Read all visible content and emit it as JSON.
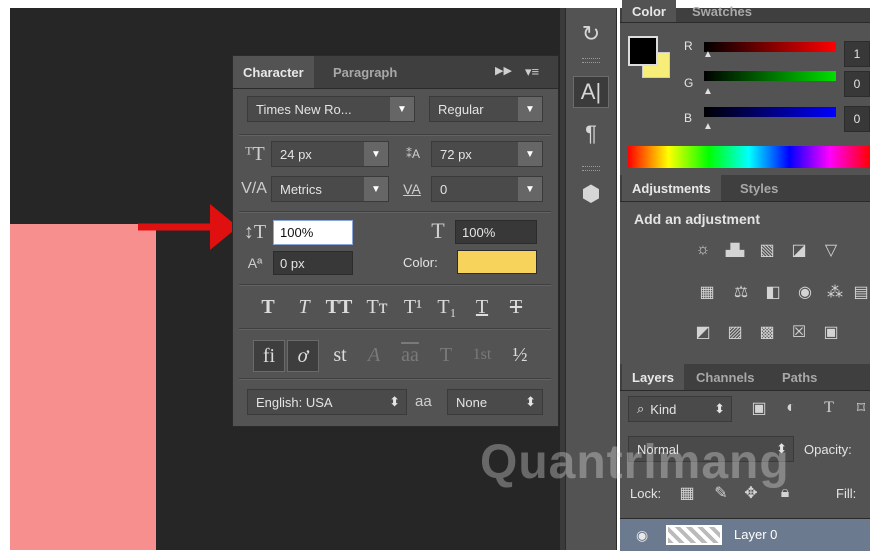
{
  "character_panel": {
    "tabs": [
      "Character",
      "Paragraph"
    ],
    "font_family": "Times New Ro...",
    "font_style": "Regular",
    "font_size": "24 px",
    "leading": "72 px",
    "kerning": "Metrics",
    "tracking": "0",
    "vertical_scale": "100%",
    "horizontal_scale": "100%",
    "baseline_shift": "0 px",
    "color_label": "Color:",
    "color_value": "#f7d35b",
    "type_styles": [
      "T",
      "T",
      "TT",
      "Tт",
      "T¹",
      "T₁",
      "T",
      "T"
    ],
    "opentype": [
      "fi",
      "ơ",
      "st",
      "A",
      "aa",
      "T",
      "1st",
      "½"
    ],
    "language": "English: USA",
    "aa_label": "aa",
    "anti_alias": "None"
  },
  "color_panel": {
    "tabs": [
      "Color",
      "Swatches"
    ],
    "r_label": "R",
    "r_value": "1",
    "g_label": "G",
    "g_value": "0",
    "b_label": "B",
    "b_value": "0",
    "foreground": "#000000",
    "background": "#f7ee7a"
  },
  "adjustments_panel": {
    "tabs": [
      "Adjustments",
      "Styles"
    ],
    "heading": "Add an adjustment"
  },
  "layers_panel": {
    "tabs": [
      "Layers",
      "Channels",
      "Paths"
    ],
    "kind": "Kind",
    "blend_mode": "Normal",
    "opacity_label": "Opacity:",
    "lock_label": "Lock:",
    "fill_label": "Fill:",
    "layer_name": "Layer 0"
  },
  "watermark": "Quantrimang",
  "colors": {
    "canvas": "#262626",
    "pink_layer": "#f78f8f",
    "arrow": "#e01010"
  }
}
